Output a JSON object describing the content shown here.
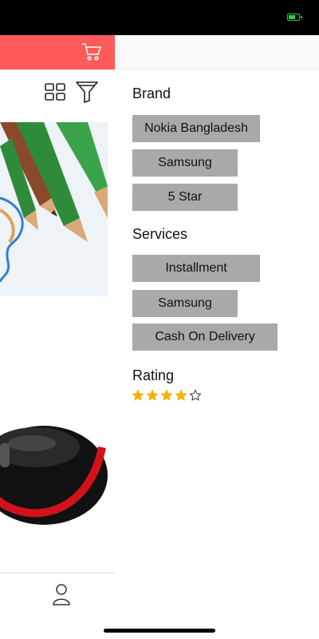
{
  "app": {
    "cart_icon": "cart-icon",
    "grid_icon": "grid-view-icon",
    "filter_icon": "filter-icon",
    "profile_icon": "profile-icon"
  },
  "filter_panel": {
    "brand": {
      "title": "Brand",
      "options": [
        "Nokia Bangladesh",
        "Samsung",
        "5 Star"
      ]
    },
    "services": {
      "title": "Services",
      "options": [
        "Installment",
        "Samsung",
        "Cash On Delivery"
      ]
    },
    "rating": {
      "title": "Rating",
      "value": 4,
      "max": 5
    }
  },
  "colors": {
    "header_accent": "#ff5a5a",
    "chip_bg": "#a9a9a9",
    "star_filled": "#f5b301",
    "battery": "#2ecc40"
  }
}
